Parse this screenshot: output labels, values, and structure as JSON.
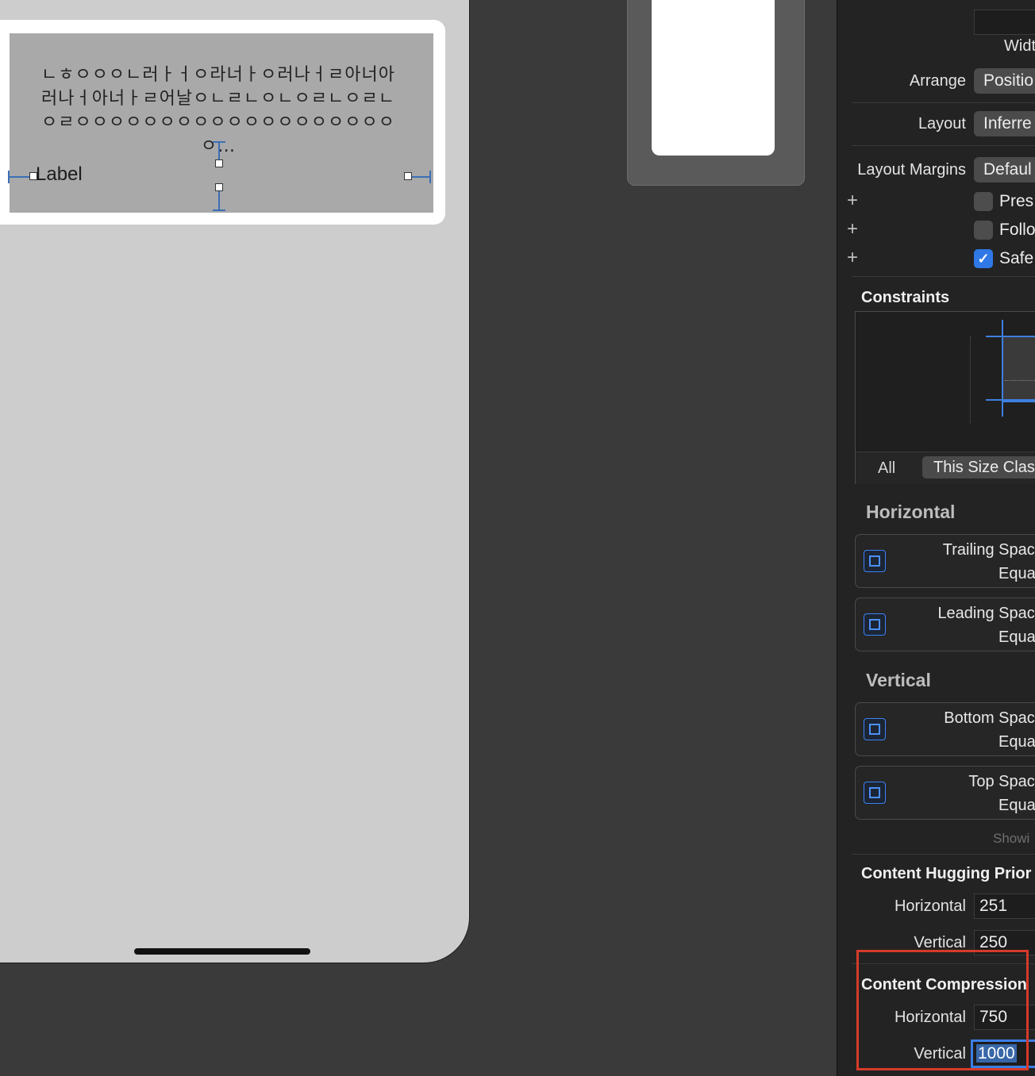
{
  "canvas": {
    "long_label_text": "ㄴㅎㅇㅇㅇㄴ러ㅏㅓㅇ라너ㅏㅇ러나ㅓㄹ아너아\n러나ㅓ아너ㅏㄹ어날ㅇㄴㄹㄴㅇㄴㅇㄹㄴㅇㄹㄴ\nㅇㄹㅇㅇㅇㅇㅇㅇㅇㅇㅇㅇㅇㅇㅇㅇㅇㅇㅇㅇㅇㅇ…",
    "short_label_text": "Label"
  },
  "inspector": {
    "width_label": "Widt",
    "arrange": {
      "label": "Arrange",
      "value": "Positio"
    },
    "layout": {
      "label": "Layout",
      "value": "Inferre"
    },
    "layout_margins": {
      "label": "Layout Margins",
      "value": "Defaul"
    },
    "checkboxes": [
      {
        "label": "Pres",
        "checked": false
      },
      {
        "label": "Follo",
        "checked": false
      },
      {
        "label": "Safe",
        "checked": true
      }
    ],
    "constraints": {
      "title": "Constraints",
      "segment_all": "All",
      "segment_size_class": "This Size Clas"
    },
    "horizontal_title": "Horizontal",
    "horizontal_items": [
      {
        "line1": "Trailing Space t",
        "line2": "Equa"
      },
      {
        "line1": "Leading Space t",
        "line2": "Equa"
      }
    ],
    "vertical_title": "Vertical",
    "vertical_items": [
      {
        "line1": "Bottom Space t",
        "line2": "Equa"
      },
      {
        "line1": "Top Space t",
        "line2": "Equa"
      }
    ],
    "showing_text": "Showi",
    "hugging": {
      "title": "Content Hugging Prior",
      "horizontal_label": "Horizontal",
      "horizontal_value": "251",
      "vertical_label": "Vertical",
      "vertical_value": "250"
    },
    "compression": {
      "title": "Content Compression",
      "horizontal_label": "Horizontal",
      "horizontal_value": "750",
      "vertical_label": "Vertical",
      "vertical_value": "1000"
    }
  },
  "colors": {
    "accent": "#2f78e6",
    "highlight": "#d63a2a",
    "canvas_bg": "#cdcdcd",
    "inspector_bg": "#232323"
  }
}
